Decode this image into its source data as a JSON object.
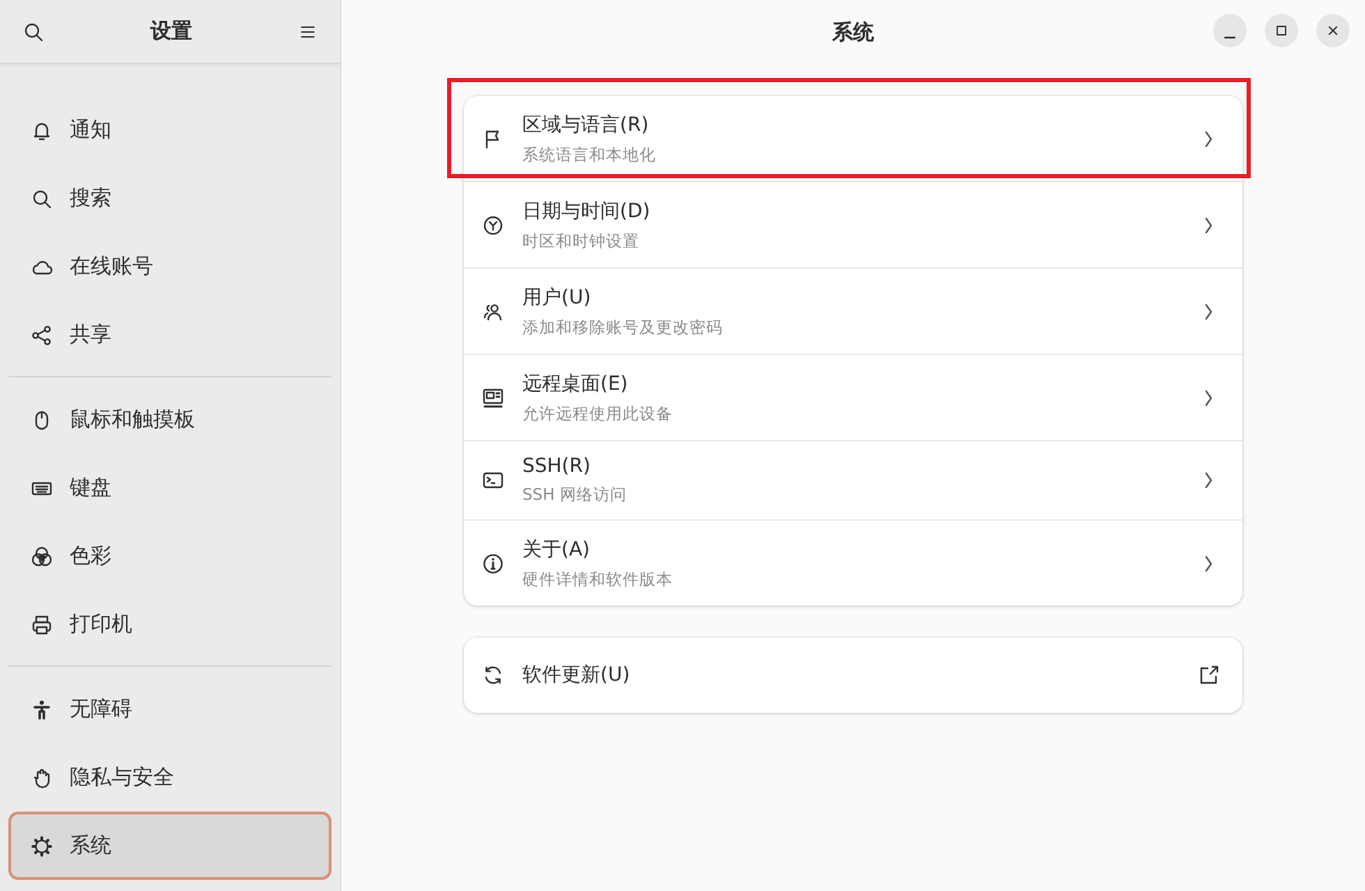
{
  "sidebar": {
    "title": "设置",
    "groups": [
      [
        {
          "label": "通知",
          "selected": false
        },
        {
          "label": "搜索",
          "selected": false
        },
        {
          "label": "在线账号",
          "selected": false
        },
        {
          "label": "共享",
          "selected": false
        }
      ],
      [
        {
          "label": "鼠标和触摸板",
          "selected": false
        },
        {
          "label": "键盘",
          "selected": false
        },
        {
          "label": "色彩",
          "selected": false
        },
        {
          "label": "打印机",
          "selected": false
        }
      ],
      [
        {
          "label": "无障碍",
          "selected": false
        },
        {
          "label": "隐私与安全",
          "selected": false
        },
        {
          "label": "系统",
          "selected": true
        }
      ]
    ]
  },
  "window": {
    "title": "系统"
  },
  "rows": [
    {
      "title": "区域与语言(R)",
      "subtitle": "系统语言和本地化",
      "highlighted": true
    },
    {
      "title": "日期与时间(D)",
      "subtitle": "时区和时钟设置",
      "highlighted": false
    },
    {
      "title": "用户(U)",
      "subtitle": "添加和移除账号及更改密码",
      "highlighted": false
    },
    {
      "title": "远程桌面(E)",
      "subtitle": "允许远程使用此设备",
      "highlighted": false
    },
    {
      "title": "SSH(R)",
      "subtitle": "SSH 网络访问",
      "highlighted": false
    },
    {
      "title": "关于(A)",
      "subtitle": "硬件详情和软件版本",
      "highlighted": false
    }
  ],
  "update_row": {
    "title": "软件更新(U)"
  }
}
